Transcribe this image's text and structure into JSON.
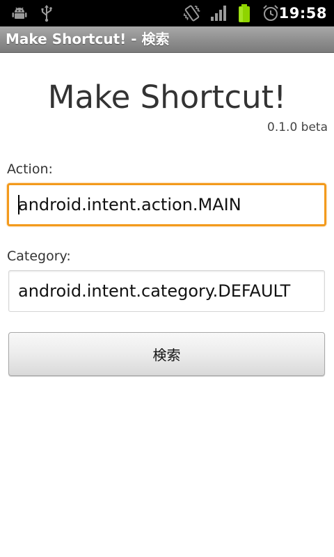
{
  "status_bar": {
    "time": "19:58",
    "icons": [
      "android-debug-icon",
      "usb-icon",
      "vibrate-icon",
      "signal-icon",
      "battery-icon",
      "alarm-icon"
    ],
    "battery_color": "#8fd400"
  },
  "title_bar": {
    "title": "Make Shortcut! - 検索"
  },
  "content": {
    "heading": "Make Shortcut!",
    "version": "0.1.0 beta",
    "action": {
      "label": "Action:",
      "value": "android.intent.action.MAIN"
    },
    "category": {
      "label": "Category:",
      "value": "android.intent.category.DEFAULT"
    },
    "search_button_label": "検索"
  },
  "colors": {
    "focus_border": "#f39a1c",
    "title_bar": "#8e8e8e"
  }
}
